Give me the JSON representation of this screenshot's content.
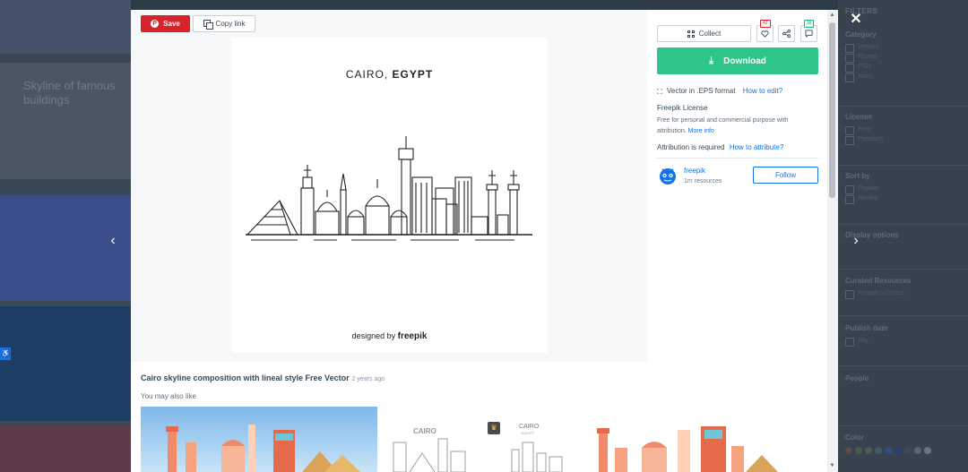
{
  "background": {
    "left_text": "Skyline of famous buildings",
    "filters": {
      "header": "FILTERS",
      "sections": [
        {
          "title": "Category",
          "options": [
            "Vectors",
            "Photos",
            "PSD",
            "Icons"
          ]
        },
        {
          "title": "License",
          "options": [
            "Free",
            "Premium"
          ]
        },
        {
          "title": "Sort by",
          "options": [
            "Popular",
            "Recent"
          ]
        },
        {
          "title": "Display options",
          "options": []
        },
        {
          "title": "Curated Resources",
          "options": [
            "Freepik's Choice"
          ]
        },
        {
          "title": "Publish date",
          "options": [
            "Any"
          ]
        },
        {
          "title": "People",
          "options": []
        },
        {
          "title": "Color",
          "options": []
        }
      ]
    }
  },
  "toolbar": {
    "save_label": "Save",
    "copy_link_label": "Copy link"
  },
  "artwork": {
    "title_city": "CAIRO, ",
    "title_country": "EGYPT",
    "credit_prefix": "designed by ",
    "credit_brand": "freepik"
  },
  "panel": {
    "collect_label": "Collect",
    "likes_count": "42",
    "comments_count": "1k",
    "download_label": "Download",
    "format_text": "Vector in .EPS format",
    "how_to_edit": "How to edit?",
    "license_title": "Freepik License",
    "license_text": "Free for personal and commercial purpose with attribution.",
    "more_info": "More info",
    "attribution_text": "Attribution is required",
    "how_to_attribute": "How to attribute?",
    "author_name": "freepik",
    "author_resources": "1m resources",
    "follow_label": "Follow"
  },
  "resource": {
    "title": "Cairo skyline composition with lineal style Free Vector",
    "age": "2 years ago",
    "also_like": "You may also like",
    "thumb2_label": "CAIRO",
    "thumb2_sub": "EGYPT"
  },
  "colors": {
    "save_red": "#d8232a",
    "download_green": "#2ec58a",
    "link_blue": "#1273eb"
  }
}
